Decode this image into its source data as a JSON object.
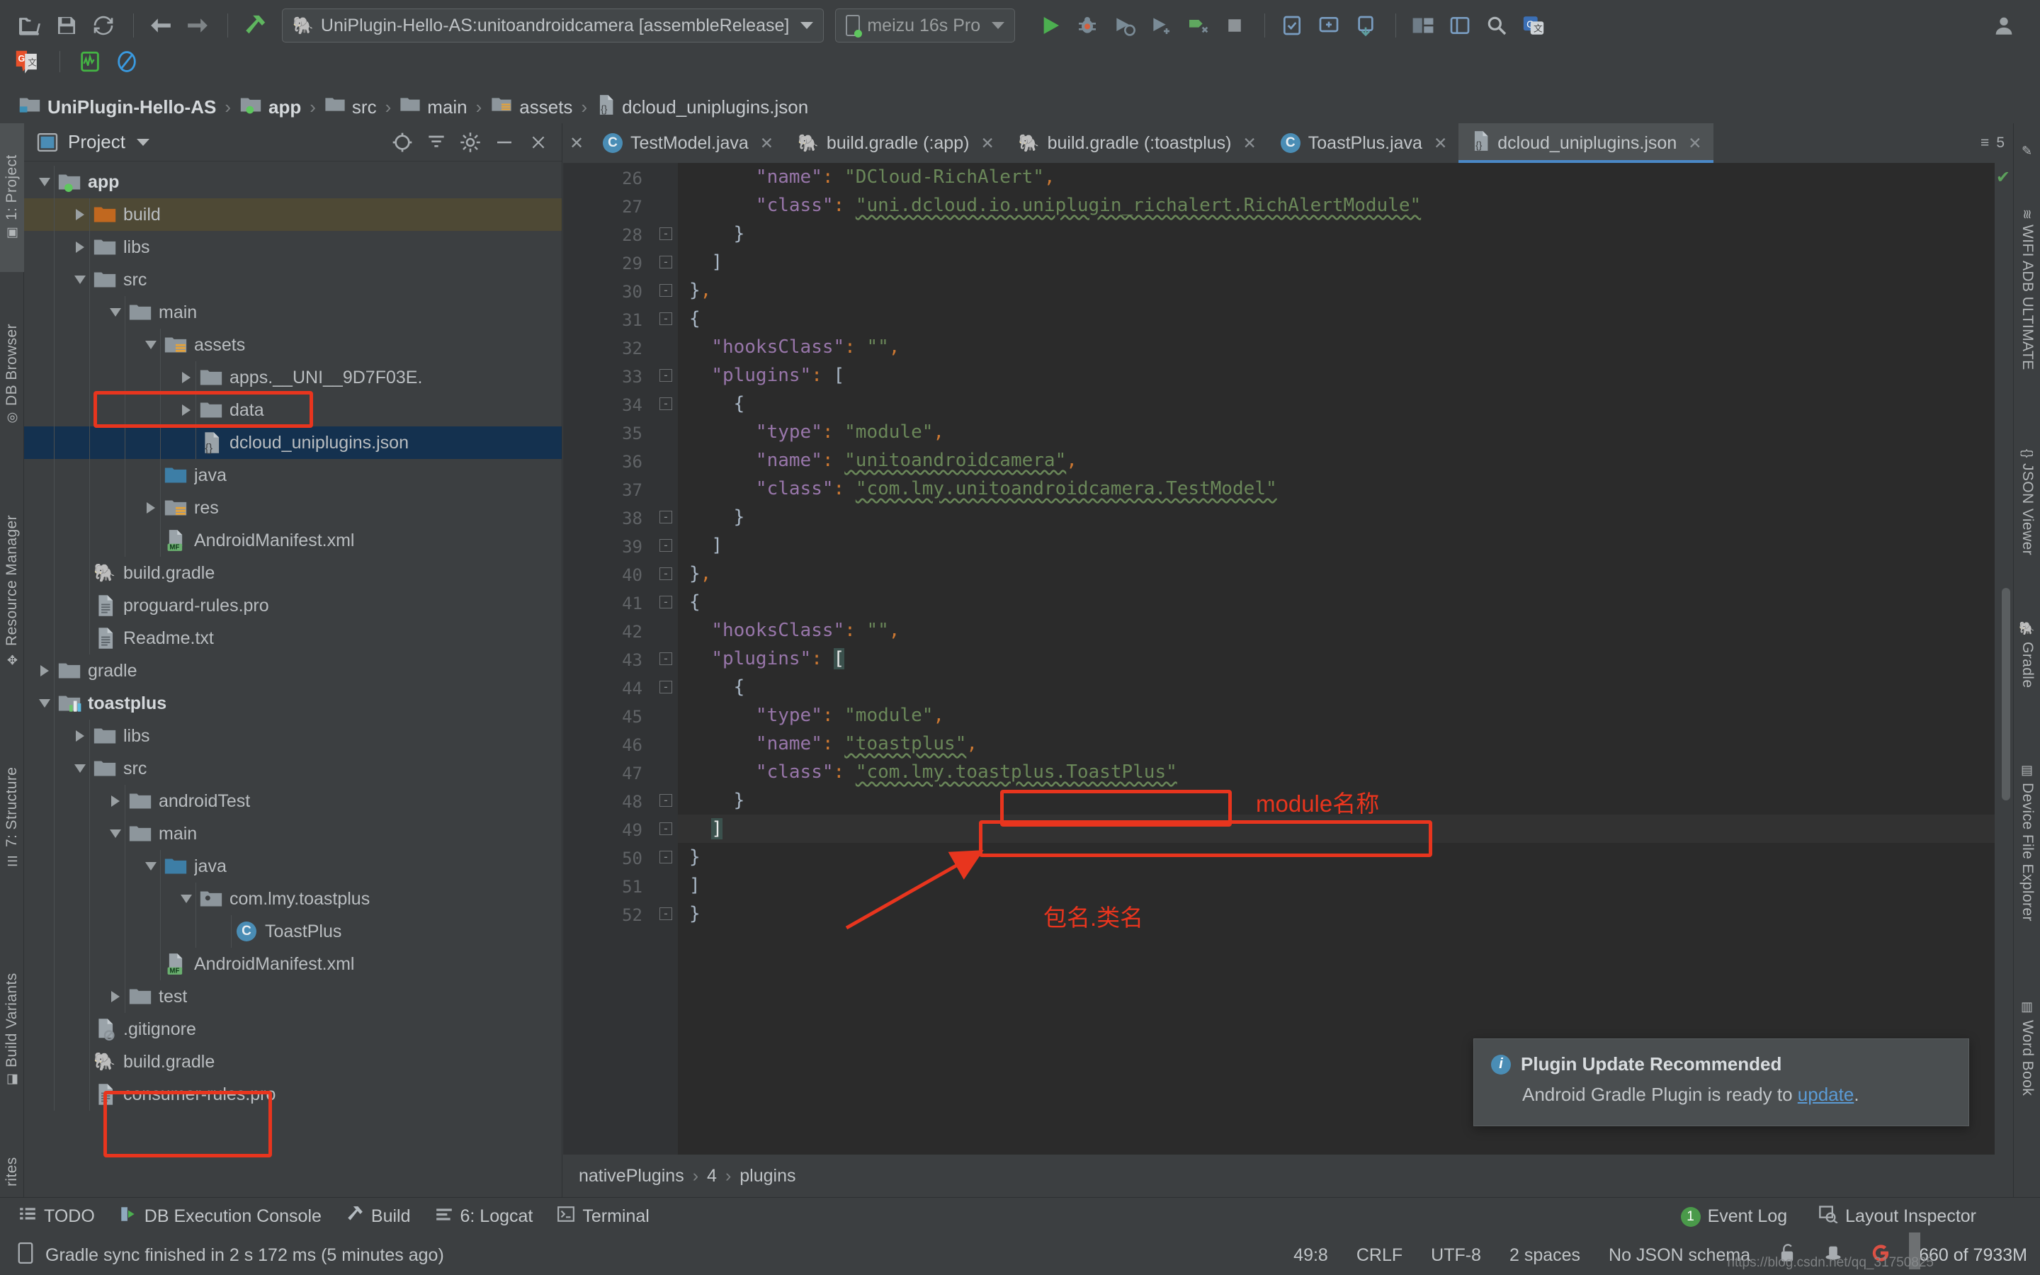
{
  "toolbar": {
    "icons": [
      "open-folder-icon",
      "save-icon",
      "sync-icon",
      "back-arrow-icon",
      "forward-arrow-icon",
      "build-icon"
    ],
    "run_config": "UniPlugin-Hello-AS:unitoandroidcamera [assembleRelease]",
    "device": "meizu 16s Pro",
    "right_icons": [
      "run-icon",
      "debug-icon",
      "run-coverage-icon",
      "profile-icon",
      "apply-changes-icon",
      "stop-icon",
      "avd-manager-icon",
      "sdk-manager-icon",
      "device-file-icon",
      "layout-inspector-icon",
      "project-structure-icon",
      "search-icon",
      "translate-icon"
    ],
    "row2_icons": [
      "google-translate-icon",
      "profiler-icon",
      "no-entry-icon"
    ]
  },
  "breadcrumb": {
    "items": [
      {
        "label": "UniPlugin-Hello-AS",
        "icon": "project-folder-icon",
        "bold": true
      },
      {
        "label": "app",
        "icon": "module-folder-icon",
        "bold": true
      },
      {
        "label": "src",
        "icon": "folder-icon",
        "bold": false
      },
      {
        "label": "main",
        "icon": "folder-icon",
        "bold": false
      },
      {
        "label": "assets",
        "icon": "assets-folder-icon",
        "bold": false
      },
      {
        "label": "dcloud_uniplugins.json",
        "icon": "json-file-icon",
        "bold": false
      }
    ],
    "separator": "›"
  },
  "left_rail": [
    {
      "label": "1: Project",
      "icon": "project-icon",
      "active": true
    },
    {
      "label": "DB Browser",
      "icon": "database-icon",
      "active": false
    },
    {
      "label": "Resource Manager",
      "icon": "resource-icon",
      "active": false
    },
    {
      "label": "7: Structure",
      "icon": "structure-icon",
      "active": false
    },
    {
      "label": "Build Variants",
      "icon": "variants-icon",
      "active": false
    },
    {
      "label": "rites",
      "icon": "favorites-icon",
      "active": false
    }
  ],
  "right_rail": [
    {
      "label": "WIFI ADB ULTIMATE",
      "icon": "wifi-icon"
    },
    {
      "label": "JSON Viewer",
      "icon": "json-icon"
    },
    {
      "label": "Gradle",
      "icon": "gradle-icon"
    },
    {
      "label": "Device File Explorer",
      "icon": "device-file-icon"
    },
    {
      "label": "Word Book",
      "icon": "book-icon"
    }
  ],
  "project_panel": {
    "title": "Project",
    "header_icons": [
      "locate-icon",
      "collapse-all-icon",
      "settings-icon",
      "hide-icon",
      "close-icon"
    ],
    "tree": [
      {
        "label": "app",
        "depth": 1,
        "arrow": "down",
        "icon": "module-folder-icon",
        "bold": true,
        "state": "none"
      },
      {
        "label": "build",
        "depth": 2,
        "arrow": "right",
        "icon": "build-folder-icon",
        "bold": false,
        "state": "brown"
      },
      {
        "label": "libs",
        "depth": 2,
        "arrow": "right",
        "icon": "folder-icon",
        "bold": false,
        "state": "none"
      },
      {
        "label": "src",
        "depth": 2,
        "arrow": "down",
        "icon": "folder-icon",
        "bold": false,
        "state": "none"
      },
      {
        "label": "main",
        "depth": 3,
        "arrow": "down",
        "icon": "folder-icon",
        "bold": false,
        "state": "none"
      },
      {
        "label": "assets",
        "depth": 4,
        "arrow": "down",
        "icon": "assets-folder-icon",
        "bold": false,
        "state": "none"
      },
      {
        "label": "apps.__UNI__9D7F03E.",
        "depth": 5,
        "arrow": "right",
        "icon": "folder-icon",
        "bold": false,
        "state": "none"
      },
      {
        "label": "data",
        "depth": 5,
        "arrow": "right",
        "icon": "folder-icon",
        "bold": false,
        "state": "none"
      },
      {
        "label": "dcloud_uniplugins.json",
        "depth": 5,
        "arrow": "none",
        "icon": "json-file-icon",
        "bold": false,
        "state": "blue"
      },
      {
        "label": "java",
        "depth": 4,
        "arrow": "none",
        "icon": "java-folder-icon",
        "bold": false,
        "state": "none"
      },
      {
        "label": "res",
        "depth": 4,
        "arrow": "right",
        "icon": "res-folder-icon",
        "bold": false,
        "state": "none"
      },
      {
        "label": "AndroidManifest.xml",
        "depth": 4,
        "arrow": "none",
        "icon": "manifest-file-icon",
        "bold": false,
        "state": "none"
      },
      {
        "label": "build.gradle",
        "depth": 2,
        "arrow": "none",
        "icon": "gradle-file-icon",
        "bold": false,
        "state": "none"
      },
      {
        "label": "proguard-rules.pro",
        "depth": 2,
        "arrow": "none",
        "icon": "text-file-icon",
        "bold": false,
        "state": "none"
      },
      {
        "label": "Readme.txt",
        "depth": 2,
        "arrow": "none",
        "icon": "text-file-icon",
        "bold": false,
        "state": "none"
      },
      {
        "label": "gradle",
        "depth": 1,
        "arrow": "right",
        "icon": "folder-icon",
        "bold": false,
        "state": "none"
      },
      {
        "label": "toastplus",
        "depth": 1,
        "arrow": "down",
        "icon": "library-module-icon",
        "bold": true,
        "state": "none"
      },
      {
        "label": "libs",
        "depth": 2,
        "arrow": "right",
        "icon": "folder-icon",
        "bold": false,
        "state": "none"
      },
      {
        "label": "src",
        "depth": 2,
        "arrow": "down",
        "icon": "folder-icon",
        "bold": false,
        "state": "none"
      },
      {
        "label": "androidTest",
        "depth": 3,
        "arrow": "right",
        "icon": "folder-icon",
        "bold": false,
        "state": "none"
      },
      {
        "label": "main",
        "depth": 3,
        "arrow": "down",
        "icon": "folder-icon",
        "bold": false,
        "state": "none"
      },
      {
        "label": "java",
        "depth": 4,
        "arrow": "down",
        "icon": "java-folder-icon",
        "bold": false,
        "state": "none"
      },
      {
        "label": "com.lmy.toastplus",
        "depth": 5,
        "arrow": "down",
        "icon": "package-icon",
        "bold": false,
        "state": "none"
      },
      {
        "label": "ToastPlus",
        "depth": 6,
        "arrow": "none",
        "icon": "java-class-icon",
        "bold": false,
        "state": "none"
      },
      {
        "label": "AndroidManifest.xml",
        "depth": 4,
        "arrow": "none",
        "icon": "manifest-file-icon",
        "bold": false,
        "state": "none"
      },
      {
        "label": "test",
        "depth": 3,
        "arrow": "right",
        "icon": "folder-icon",
        "bold": false,
        "state": "none"
      },
      {
        "label": ".gitignore",
        "depth": 2,
        "arrow": "none",
        "icon": "gitignore-file-icon",
        "bold": false,
        "state": "none"
      },
      {
        "label": "build.gradle",
        "depth": 2,
        "arrow": "none",
        "icon": "gradle-file-icon",
        "bold": false,
        "state": "none"
      },
      {
        "label": "consumer-rules.pro",
        "depth": 2,
        "arrow": "none",
        "icon": "text-file-icon",
        "bold": false,
        "state": "none"
      }
    ]
  },
  "editor": {
    "tabs": [
      {
        "label": "TestModel.java",
        "icon": "java-class-icon",
        "active": false,
        "closable": true
      },
      {
        "label": "build.gradle (:app)",
        "icon": "gradle-file-icon",
        "active": false,
        "closable": true
      },
      {
        "label": "build.gradle (:toastplus)",
        "icon": "gradle-file-icon",
        "active": false,
        "closable": true
      },
      {
        "label": "ToastPlus.java",
        "icon": "java-class-icon",
        "active": false,
        "closable": true
      },
      {
        "label": "dcloud_uniplugins.json",
        "icon": "json-file-icon",
        "active": true,
        "closable": true
      }
    ],
    "tabs_right_label": "5",
    "first_line_number": 26,
    "lines": [
      {
        "n": 26,
        "fold": "",
        "html": "      <span class=\"k\">\"name\"</span><span class=\"p\">:</span> <span class=\"s\">\"DCloud-RichAlert\"</span><span class=\"p\">,</span>"
      },
      {
        "n": 27,
        "fold": "",
        "html": "      <span class=\"k\">\"class\"</span><span class=\"p\">:</span> <span class=\"s wavy\">\"uni.dcloud.io.uniplugin_richalert.RichAlertModule\"</span>"
      },
      {
        "n": 28,
        "fold": "minus",
        "html": "    <span class=\"br\">}</span>"
      },
      {
        "n": 29,
        "fold": "minus",
        "html": "  <span class=\"br\">]</span>"
      },
      {
        "n": 30,
        "fold": "minus",
        "html": "<span class=\"br\">}</span><span class=\"p\">,</span>"
      },
      {
        "n": 31,
        "fold": "minus",
        "html": "<span class=\"br\">{</span>"
      },
      {
        "n": 32,
        "fold": "",
        "html": "  <span class=\"k\">\"hooksClass\"</span><span class=\"p\">:</span> <span class=\"s\">\"\"</span><span class=\"p\">,</span>"
      },
      {
        "n": 33,
        "fold": "minus",
        "html": "  <span class=\"k\">\"plugins\"</span><span class=\"p\">:</span> <span class=\"br\">[</span>"
      },
      {
        "n": 34,
        "fold": "minus",
        "html": "    <span class=\"br\">{</span>"
      },
      {
        "n": 35,
        "fold": "",
        "html": "      <span class=\"k\">\"type\"</span><span class=\"p\">:</span> <span class=\"s\">\"module\"</span><span class=\"p\">,</span>"
      },
      {
        "n": 36,
        "fold": "",
        "html": "      <span class=\"k\">\"name\"</span><span class=\"p\">:</span> <span class=\"s wavy\">\"unitoandroidcamera\"</span><span class=\"p\">,</span>"
      },
      {
        "n": 37,
        "fold": "",
        "html": "      <span class=\"k\">\"class\"</span><span class=\"p\">:</span> <span class=\"s wavy\">\"com.lmy.unitoandroidcamera.TestModel\"</span>"
      },
      {
        "n": 38,
        "fold": "minus",
        "html": "    <span class=\"br\">}</span>"
      },
      {
        "n": 39,
        "fold": "minus",
        "html": "  <span class=\"br\">]</span>"
      },
      {
        "n": 40,
        "fold": "minus",
        "html": "<span class=\"br\">}</span><span class=\"p\">,</span>"
      },
      {
        "n": 41,
        "fold": "minus",
        "html": "<span class=\"br\">{</span>"
      },
      {
        "n": 42,
        "fold": "",
        "html": "  <span class=\"k\">\"hooksClass\"</span><span class=\"p\">:</span> <span class=\"s\">\"\"</span><span class=\"p\">,</span>"
      },
      {
        "n": 43,
        "fold": "minus",
        "html": "  <span class=\"k\">\"plugins\"</span><span class=\"p\">:</span> <span class=\"brhl\">[</span>"
      },
      {
        "n": 44,
        "fold": "minus",
        "html": "    <span class=\"br\">{</span>"
      },
      {
        "n": 45,
        "fold": "",
        "html": "      <span class=\"k\">\"type\"</span><span class=\"p\">:</span> <span class=\"s\">\"module\"</span><span class=\"p\">,</span>"
      },
      {
        "n": 46,
        "fold": "",
        "html": "      <span class=\"k\">\"name\"</span><span class=\"p\">:</span> <span class=\"s wavy\">\"toastplus\"</span><span class=\"p\">,</span>"
      },
      {
        "n": 47,
        "fold": "",
        "html": "      <span class=\"k\">\"class\"</span><span class=\"p\">:</span> <span class=\"s wavy\">\"com.lmy.toastplus.ToastPlus\"</span>"
      },
      {
        "n": 48,
        "fold": "minus",
        "html": "    <span class=\"br\">}</span>"
      },
      {
        "n": 49,
        "fold": "minus",
        "html": "  <span class=\"brhl\">]</span>",
        "current": true
      },
      {
        "n": 50,
        "fold": "minus",
        "html": "<span class=\"br\">}</span>"
      },
      {
        "n": 51,
        "fold": "",
        "html": "<span class=\"br\">]</span>"
      },
      {
        "n": 52,
        "fold": "minus",
        "html": "<span class=\"br\">}</span>"
      }
    ],
    "status_breadcrumb": [
      "nativePlugins",
      "4",
      "plugins"
    ],
    "status_separator": "›"
  },
  "annotations": {
    "module_name_label": "module名称",
    "package_class_label": "包名.类名"
  },
  "notification": {
    "title": "Plugin Update Recommended",
    "body_before": "Android Gradle Plugin is ready to ",
    "link": "update",
    "body_after": ".",
    "icon": "info-icon"
  },
  "bottom_bar": {
    "left_items": [
      {
        "label": "TODO",
        "icon": "todo-icon"
      },
      {
        "label": "DB Execution Console",
        "icon": "db-console-icon"
      },
      {
        "label": "Build",
        "icon": "build-icon"
      },
      {
        "label": "6: Logcat",
        "icon": "logcat-icon"
      },
      {
        "label": "Terminal",
        "icon": "terminal-icon"
      }
    ],
    "right_items": [
      {
        "label": "Event Log",
        "icon": "event-log-icon",
        "badge": "1"
      },
      {
        "label": "Layout Inspector",
        "icon": "layout-inspector-icon",
        "badge": ""
      }
    ]
  },
  "status_bar": {
    "message": "Gradle sync finished in 2 s 172 ms (5 minutes ago)",
    "message_icon": "device-icon",
    "caret": "49:8",
    "line_separator": "CRLF",
    "encoding": "UTF-8",
    "indent": "2 spaces",
    "schema": "No JSON schema",
    "icons": [
      "lock-open-icon",
      "inspector-hat-icon",
      "google-icon"
    ],
    "memory": "660 of 7933M",
    "watermark": "https://blog.csdn.net/qq_31750825"
  },
  "colors": {
    "accent_blue": "#4a88c7",
    "annotation_red": "#e8351e",
    "selection_blue": "#14314f",
    "selection_brown": "#4e4935",
    "editor_bg": "#2b2b2b",
    "chrome_bg": "#3c3f41",
    "string_green": "#6a8759",
    "key_purple": "#9876aa",
    "punct_orange": "#cc7832"
  }
}
